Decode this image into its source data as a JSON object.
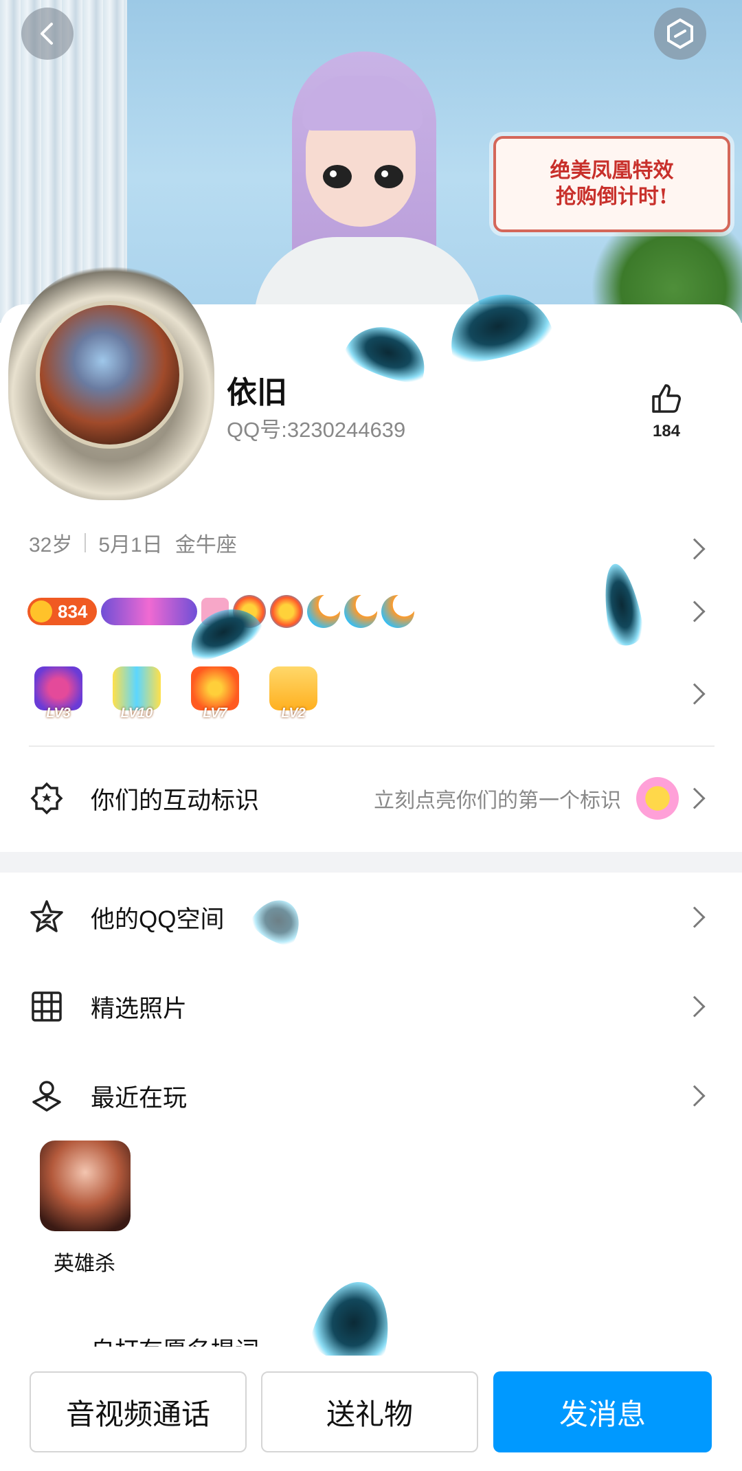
{
  "banner": {
    "promo_line1": "绝美凤凰特效",
    "promo_line2": "抢购倒计时!"
  },
  "profile": {
    "name": "依旧",
    "qq_label": "QQ号:",
    "qq_number": "3230244639",
    "likes": "184",
    "age": "32岁",
    "birthday": "5月1日",
    "zodiac": "金牛座"
  },
  "badges": {
    "coin_value": "834",
    "wing_level": "10",
    "levels": [
      "LV3",
      "LV10",
      "LV7",
      "LV2"
    ]
  },
  "interaction": {
    "label": "你们的互动标识",
    "hint": "立刻点亮你们的第一个标识"
  },
  "menu": [
    {
      "label": "他的QQ空间",
      "icon": "star-space-icon"
    },
    {
      "label": "精选照片",
      "icon": "grid-icon"
    },
    {
      "label": "最近在玩",
      "icon": "game-pin-icon"
    }
  ],
  "recent_game": {
    "name": "英雄杀"
  },
  "partial_row_label": "自打有愿名提词",
  "actions": {
    "call": "音视频通话",
    "gift": "送礼物",
    "message": "发消息"
  },
  "colors": {
    "primary": "#0099ff",
    "coin": "#f05a22"
  }
}
